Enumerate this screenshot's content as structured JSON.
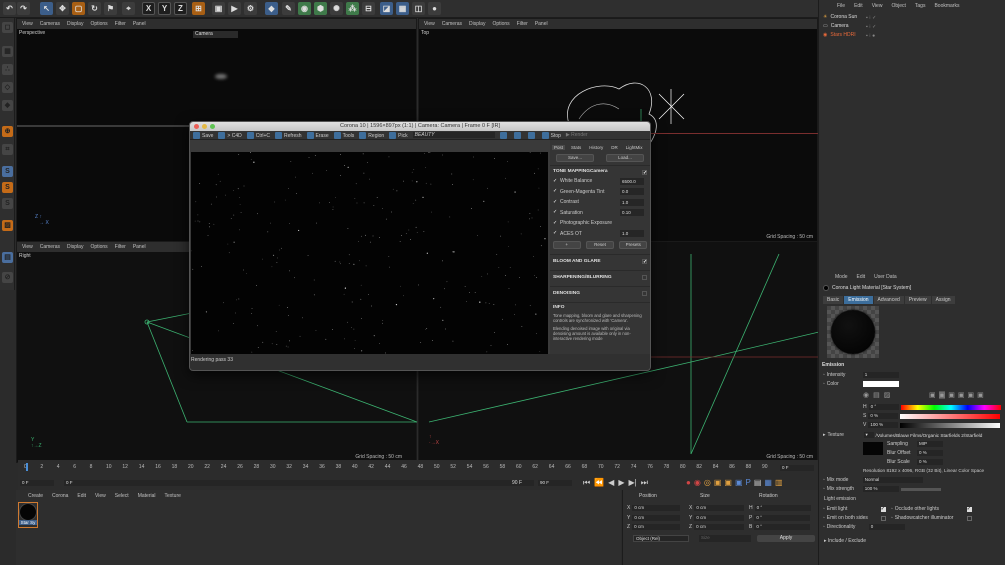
{
  "top_menu": {
    "items": [
      "View",
      "Cameras",
      "Display",
      "Options",
      "Filter",
      "Panel"
    ]
  },
  "viewports": {
    "perspective": {
      "title": "Perspective",
      "camera": "Camera"
    },
    "top": {
      "title": "Top",
      "menu": [
        "View",
        "Cameras",
        "Display",
        "Options",
        "Filter",
        "Panel"
      ],
      "grid": "Grid Spacing : 50 cm"
    },
    "right": {
      "title": "Right",
      "menu": [
        "View",
        "Cameras",
        "Display",
        "Options",
        "Filter",
        "Panel"
      ],
      "grid": "Grid Spacing : 50 cm"
    },
    "front": {
      "grid": "Grid Spacing : 50 cm"
    }
  },
  "object_manager": {
    "menu": [
      "File",
      "Edit",
      "View",
      "Object",
      "Tags",
      "Bookmarks"
    ],
    "objects": [
      {
        "name": "Corona Sun",
        "color": "#c8c8c8"
      },
      {
        "name": "Camera",
        "color": "#c8c8c8"
      },
      {
        "name": "Stars HDRI",
        "color": "#e8693a"
      }
    ]
  },
  "vfb": {
    "title": "Corona 10 | 1596×897px (1:1) | Camera: Camera | Frame 0 F [IR]",
    "toolbar": {
      "save": "Save",
      "to_c4d": "> C4D",
      "ctrl_c": "Ctrl+C",
      "refresh": "Refresh",
      "erase": "Erase",
      "tools": "Tools",
      "region": "Region",
      "pick": "Pick",
      "pass": "BEAUTY",
      "stop": "Stop",
      "render": "Render"
    },
    "tabs": [
      "Post",
      "Stats",
      "History",
      "DR",
      "LightMix"
    ],
    "save_btn": "Save...",
    "load_btn": "Load...",
    "tone_mapping": {
      "label": "TONE MAPPING",
      "camera": "Camera",
      "rows": [
        {
          "label": "White Balance",
          "value": "6500.0"
        },
        {
          "label": "Green-Magenta Tint",
          "value": "0.0"
        },
        {
          "label": "Contrast",
          "value": "1.0"
        },
        {
          "label": "Saturation",
          "value": "0.10"
        },
        {
          "label": "Photographic Exposure",
          "value": ""
        },
        {
          "label": "ACES OT",
          "value": "1.0"
        }
      ]
    },
    "plus": "+",
    "reset": "Reset",
    "presets": "Presets",
    "sections": [
      "BLOOM AND GLARE",
      "SHARPENING/BLURRING",
      "DENOISING"
    ],
    "info_label": "INFO",
    "info1": "Tone mapping, bloom and glare and sharpening controls are synchronized with 'Camera'.",
    "info2": "Blending denoised image with original via denoising amount is available only in non-interactive rendering mode",
    "status": "Rendering pass 33"
  },
  "timeline": {
    "ticks": [
      "0",
      "2",
      "4",
      "6",
      "8",
      "10",
      "12",
      "14",
      "16",
      "18",
      "20",
      "22",
      "24",
      "26",
      "28",
      "30",
      "32",
      "34",
      "36",
      "38",
      "40",
      "42",
      "44",
      "46",
      "48",
      "50",
      "52",
      "54",
      "56",
      "58",
      "60",
      "62",
      "64",
      "66",
      "68",
      "70",
      "72",
      "74",
      "76",
      "78",
      "80",
      "82",
      "84",
      "86",
      "88",
      "90"
    ],
    "start": "0 F",
    "current": "0 F",
    "end1": "90 F",
    "end2": "90 F",
    "right": "0 F"
  },
  "material_manager": {
    "menu": [
      "Create",
      "Corona",
      "Edit",
      "View",
      "Select",
      "Material",
      "Texture"
    ],
    "material": "Star Sy"
  },
  "coords": {
    "headers": [
      "Position",
      "Size",
      "Rotation"
    ],
    "rows": [
      {
        "axis": "X",
        "pos": "0 cm",
        "saxis": "X",
        "size": "0 cm",
        "raxis": "H",
        "rot": "0 °"
      },
      {
        "axis": "Y",
        "pos": "0 cm",
        "saxis": "Y",
        "size": "0 cm",
        "raxis": "P",
        "rot": "0 °"
      },
      {
        "axis": "Z",
        "pos": "0 cm",
        "saxis": "Z",
        "size": "0 cm",
        "raxis": "B",
        "rot": "0 °"
      }
    ],
    "mode": "Object (Rel)",
    "size_mode": "Size",
    "apply": "Apply"
  },
  "attributes": {
    "menu": [
      "Mode",
      "Edit",
      "User Data"
    ],
    "title": "Corona Light Material [Star System]",
    "tabs": [
      "Basic",
      "Emission",
      "Advanced",
      "Preview",
      "Assign"
    ],
    "emission_label": "Emission",
    "intensity_label": "Intensity",
    "intensity": "1",
    "color_label": "Color",
    "h": "0 °",
    "s": "0 %",
    "v": "100 %",
    "texture_label": "Texture",
    "texture_path": "/Volumes/Blauw Films/Organic Starfields 2/Starfield",
    "sampling_label": "Sampling",
    "sampling": "MIP",
    "blur_offset_label": "Blur Offset",
    "blur_offset": "0 %",
    "blur_scale_label": "Blur Scale",
    "blur_scale": "0 %",
    "resolution": "Resolution 8192 x 4096, RGB (32 Bit), Linear Color Space",
    "mix_mode_label": "Mix mode",
    "mix_mode": "Normal",
    "mix_strength_label": "Mix strength",
    "mix_strength": "100 %",
    "light_emission": "Light emission",
    "emit_light": "Emit light",
    "emit_both": "Emit on both sides",
    "directionality": "Directionality",
    "directionality_val": "0",
    "occlude": "Occlude other lights",
    "shadowcatcher": "Shadowcatcher illuminator",
    "include_exclude": "▸ Include / Exclude"
  }
}
